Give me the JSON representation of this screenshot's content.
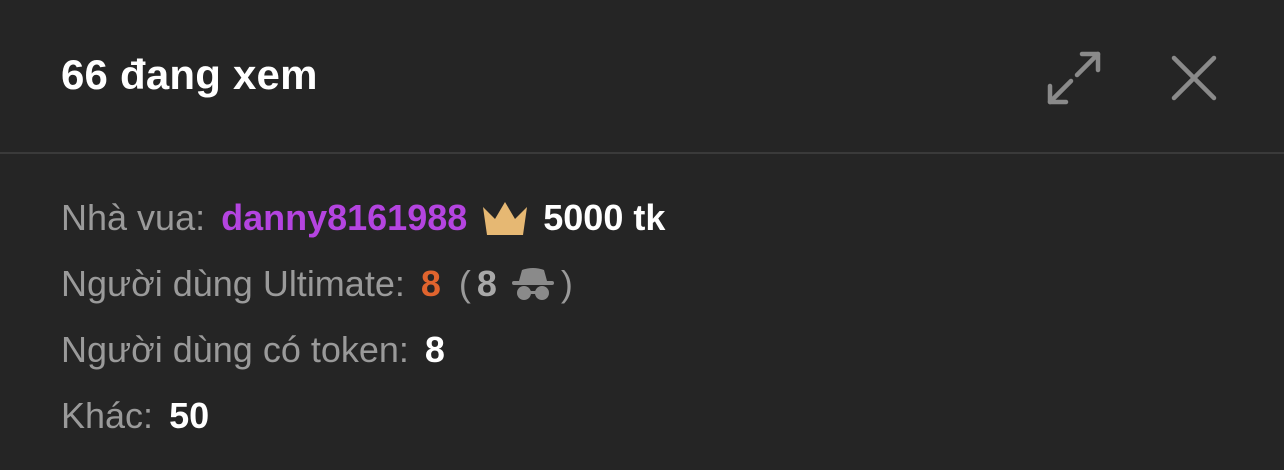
{
  "header": {
    "title": "66 đang xem",
    "expand_icon": "expand-arrows-icon",
    "close_icon": "close-x-icon"
  },
  "stats": {
    "king": {
      "label": "Nhà vua:",
      "username": "danny8161988",
      "icon": "crown-icon",
      "tokens": "5000 tk"
    },
    "ultimate": {
      "label": "Người dùng Ultimate:",
      "count": "8",
      "paren_open": "(",
      "anonymous_count": "8",
      "anonymous_icon": "incognito-spy-icon",
      "paren_close": ")"
    },
    "token_users": {
      "label": "Người dùng có token:",
      "count": "8"
    },
    "other": {
      "label": "Khác:",
      "count": "50"
    }
  },
  "colors": {
    "background": "#252525",
    "label": "#9a9a9a",
    "username": "#b444e0",
    "ultimate_count": "#e0642e",
    "crown": "#e6b873",
    "icon": "#8a8a8a"
  }
}
